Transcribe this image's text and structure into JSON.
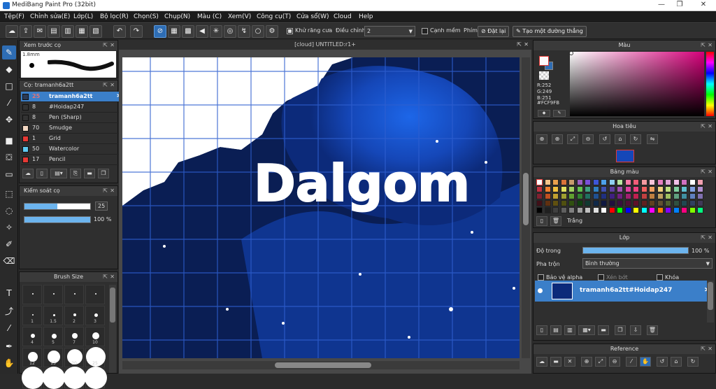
{
  "window": {
    "title": "MediBang Paint Pro (32bit)",
    "minimize": "—",
    "restore": "❐",
    "close": "✕"
  },
  "menu": [
    "Tệp(F)",
    "Chỉnh sửa(E)",
    "Lớp(L)",
    "Bộ lọc(R)",
    "Chọn(S)",
    "Chụp(N)",
    "Màu (C)",
    "Xem(V)",
    "Công cụ(T)",
    "Cửa sổ(W)",
    "Cloud",
    "Help"
  ],
  "toolbar": {
    "antialias_label": "Khử răng cưa",
    "adjust_label": "Điều chỉnh",
    "adjust_value": "2",
    "edge_label": "Cạnh mềm",
    "key_label": "Phím",
    "reset_label": "Đặt lại",
    "line_label": "Tạo một đường thẳng"
  },
  "brush_preview": {
    "title": "Xem trước cọ",
    "size": "1.8mm"
  },
  "brush_panel": {
    "title": "Cọ: tramanh6a2tt",
    "items": [
      {
        "size": "25",
        "name": "tramanh6a2tt",
        "color": "#2b3a55",
        "selected": true
      },
      {
        "size": "8",
        "name": "#Hoidap247",
        "color": "#333333",
        "selected": false
      },
      {
        "size": "8",
        "name": "Pen (Sharp)",
        "color": "#333333",
        "selected": false
      },
      {
        "size": "70",
        "name": "Smudge",
        "color": "#f3d7c2",
        "selected": false
      },
      {
        "size": "1",
        "name": "Grid",
        "color": "#e53935",
        "selected": false
      },
      {
        "size": "50",
        "name": "Watercolor",
        "color": "#5ec8f0",
        "selected": false
      },
      {
        "size": "17",
        "name": "Pencil",
        "color": "#e53935",
        "selected": false
      }
    ]
  },
  "brush_control": {
    "title": "Kiểm soát cọ",
    "size_value": "25",
    "size_frac": 0.5,
    "opacity_value": "100 %",
    "opacity_frac": 1.0
  },
  "brush_size": {
    "title": "Brush Size",
    "sizes": [
      "",
      "",
      "",
      "",
      "1",
      "1.5",
      "2",
      "3",
      "4",
      "5",
      "7",
      "10",
      "12",
      "15",
      "20",
      "25",
      "",
      "",
      "",
      ""
    ]
  },
  "canvas": {
    "tab_title": "[cloud] UNTITLED:r1+",
    "artwork_text": "Dalgom"
  },
  "color_panel": {
    "title": "Màu",
    "r": "R:252",
    "g": "G:249",
    "b": "B:251",
    "hex": "#FCF9FB",
    "primary": "#fcf9fb",
    "accent": "#2e6db4"
  },
  "navigator": {
    "title": "Hoa tiêu"
  },
  "palette": {
    "title": "Bảng màu",
    "selected_name": "Trắng",
    "colors": [
      "#ffffff",
      "#f4c48a",
      "#e8a04d",
      "#d9733a",
      "#c89b6d",
      "#9b5fc0",
      "#7a4fd8",
      "#3d56d8",
      "#4da0e8",
      "#8fd0f0",
      "#b8e6a0",
      "#ff7aa8",
      "#f25c78",
      "#f39aa0",
      "#f7c3d8",
      "#e57fc0",
      "#e0a3d6",
      "#f0c0e8",
      "#d070c0",
      "#ffffff",
      "#f0a0b0",
      "#c03040",
      "#f08030",
      "#f0c040",
      "#e0e060",
      "#a0d060",
      "#60c050",
      "#40a080",
      "#3080c0",
      "#4050b0",
      "#6040a0",
      "#a050b0",
      "#e040a0",
      "#f04080",
      "#f06060",
      "#f0a060",
      "#f0d080",
      "#c0e080",
      "#80d0a0",
      "#60c0d0",
      "#80a0e0",
      "#b090d0",
      "#802030",
      "#c05020",
      "#c0a030",
      "#a0a030",
      "#60a030",
      "#308030",
      "#207060",
      "#205090",
      "#203080",
      "#402080",
      "#702080",
      "#a02070",
      "#c02050",
      "#c04040",
      "#c08040",
      "#c0a060",
      "#a0c060",
      "#60a080",
      "#4090a0",
      "#6080c0",
      "#8070b0",
      "#401018",
      "#603010",
      "#605010",
      "#505010",
      "#305010",
      "#104010",
      "#103830",
      "#102848",
      "#101840",
      "#201040",
      "#381040",
      "#501038",
      "#601028",
      "#602020",
      "#604020",
      "#605030",
      "#506030",
      "#305040",
      "#204850",
      "#304060",
      "#403858",
      "#000000",
      "#202020",
      "#404040",
      "#606060",
      "#808080",
      "#a0a0a0",
      "#c0c0c0",
      "#e0e0e0",
      "#ffffff",
      "#ff0000",
      "#00ff00",
      "#0000ff",
      "#ffff00",
      "#00ffff",
      "#ff00ff",
      "#ff8000",
      "#8000ff",
      "#0080ff",
      "#ff0080",
      "#80ff00",
      "#00ff80"
    ]
  },
  "layers": {
    "title": "Lớp",
    "opacity_label": "Độ trong",
    "opacity_value": "100 %",
    "opacity_frac": 1.0,
    "blend_label": "Pha trộn",
    "blend_value": "Bình thường",
    "protect_alpha": "Bảo vệ alpha",
    "clipping": "Xén bớt",
    "lock": "Khóa",
    "layer_name": "tramanh6a2tt#Hoidap247"
  },
  "reference": {
    "title": "Reference"
  }
}
